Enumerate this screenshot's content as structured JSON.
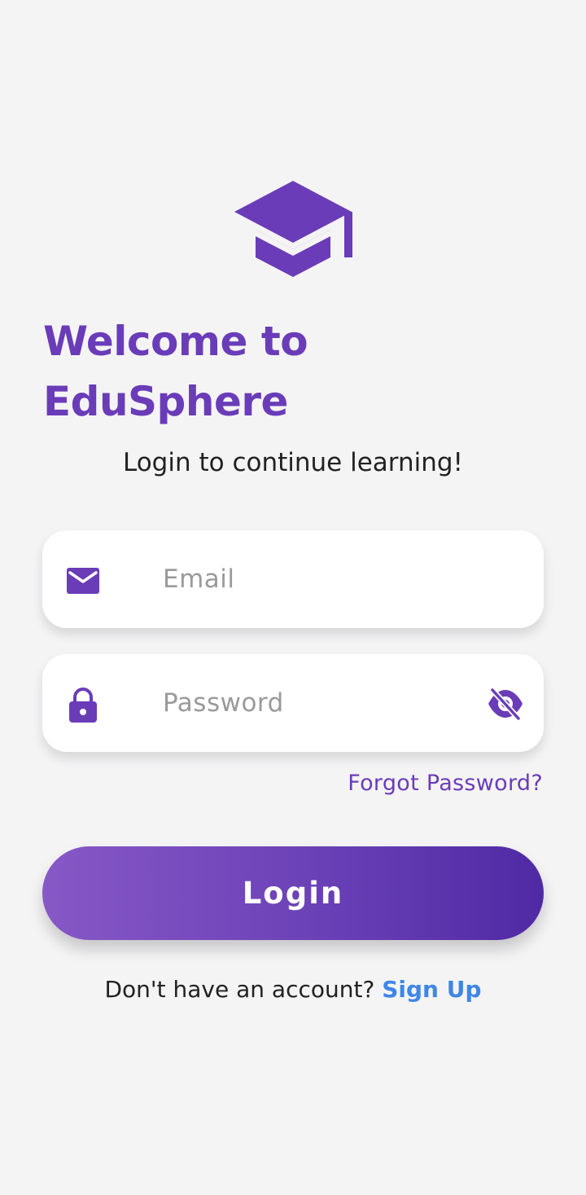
{
  "app": {
    "title_line1": "Welcome to",
    "title_line2": "EduSphere",
    "subtitle": "Login to continue learning!"
  },
  "form": {
    "email": {
      "placeholder": "Email",
      "value": ""
    },
    "password": {
      "placeholder": "Password",
      "value": ""
    },
    "forgot_label": "Forgot Password?",
    "login_label": "Login"
  },
  "footer": {
    "prompt": "Don't have an account?",
    "signup_label": "Sign Up"
  },
  "icons": {
    "logo": "graduation-cap-icon",
    "email": "envelope-icon",
    "password": "lock-icon",
    "visibility": "eye-off-icon"
  },
  "colors": {
    "brand": "#6a3cb8",
    "link": "#3f86e6",
    "background": "#f4f4f5"
  }
}
